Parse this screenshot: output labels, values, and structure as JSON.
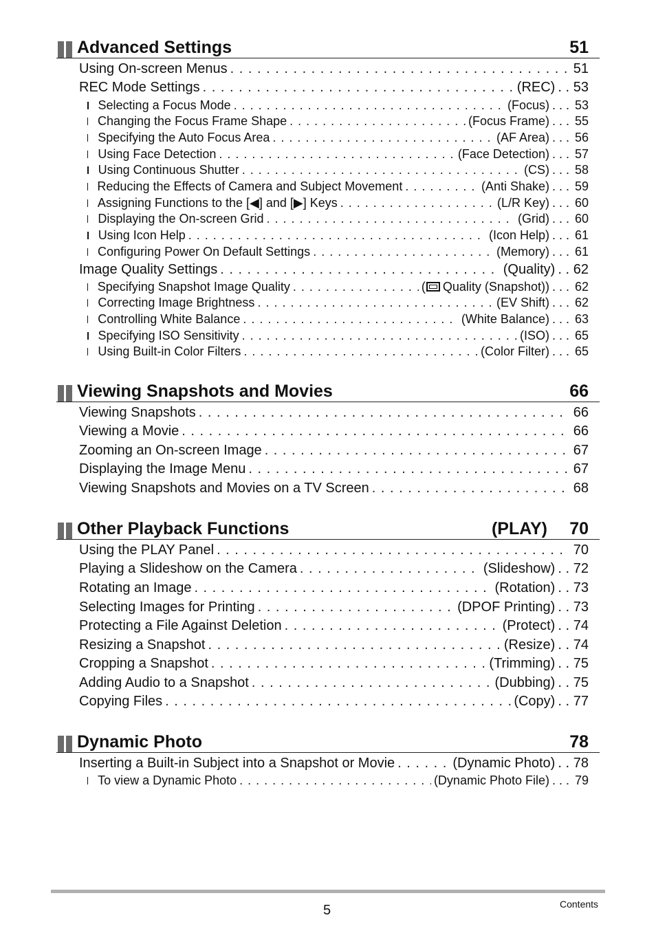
{
  "sections": [
    {
      "title": "Advanced Settings",
      "tag": "",
      "page": "51",
      "entries": [
        {
          "label": "Using On-screen Menus",
          "tag": "",
          "page": "51",
          "level": 1
        },
        {
          "label": "REC Mode Settings",
          "tag": "(REC)",
          "page": "53",
          "level": 1
        },
        {
          "label": "Selecting a Focus Mode",
          "tag": "(Focus)",
          "page": "53",
          "level": 2
        },
        {
          "label": "Changing the Focus Frame Shape",
          "tag": "(Focus Frame)",
          "page": "55",
          "level": 2
        },
        {
          "label": "Specifying the Auto Focus Area",
          "tag": "(AF Area)",
          "page": "56",
          "level": 2
        },
        {
          "label": "Using Face Detection",
          "tag": "(Face Detection)",
          "page": "57",
          "level": 2
        },
        {
          "label": "Using Continuous Shutter",
          "tag": "(CS)",
          "page": "58",
          "level": 2
        },
        {
          "label": "Reducing the Effects of Camera and Subject Movement",
          "tag": "(Anti Shake)",
          "page": "59",
          "level": 2
        },
        {
          "label": "Assigning Functions to the [◀] and [▶] Keys",
          "tag": "(L/R Key)",
          "page": "60",
          "level": 2
        },
        {
          "label": "Displaying the On-screen Grid",
          "tag": "(Grid)",
          "page": "60",
          "level": 2
        },
        {
          "label": "Using Icon Help",
          "tag": "(Icon Help)",
          "page": "61",
          "level": 2
        },
        {
          "label": "Configuring Power On Default Settings",
          "tag": "(Memory)",
          "page": "61",
          "level": 2
        },
        {
          "label": "Image Quality Settings",
          "tag": "(Quality)",
          "page": "62",
          "level": 1
        },
        {
          "label": "Specifying Snapshot Image Quality",
          "tag": "Quality (Snapshot))",
          "tag_prefix": "(",
          "tag_icon": "snapshot-quality-icon",
          "page": "62",
          "level": 2
        },
        {
          "label": "Correcting Image Brightness",
          "tag": "(EV Shift)",
          "page": "62",
          "level": 2
        },
        {
          "label": "Controlling White Balance",
          "tag": "(White Balance)",
          "page": "63",
          "level": 2
        },
        {
          "label": "Specifying ISO Sensitivity",
          "tag": "(ISO)",
          "page": "65",
          "level": 2
        },
        {
          "label": "Using Built-in Color Filters",
          "tag": "(Color Filter)",
          "page": "65",
          "level": 2
        }
      ]
    },
    {
      "title": "Viewing Snapshots and Movies",
      "tag": "",
      "page": "66",
      "entries": [
        {
          "label": "Viewing Snapshots",
          "tag": "",
          "page": "66",
          "level": 1
        },
        {
          "label": "Viewing a Movie",
          "tag": "",
          "page": "66",
          "level": 1
        },
        {
          "label": "Zooming an On-screen Image",
          "tag": "",
          "page": "67",
          "level": 1
        },
        {
          "label": "Displaying the Image Menu",
          "tag": "",
          "page": "67",
          "level": 1
        },
        {
          "label": "Viewing Snapshots and Movies on a TV Screen",
          "tag": "",
          "page": "68",
          "level": 1
        }
      ]
    },
    {
      "title": "Other Playback Functions",
      "tag": "(PLAY)",
      "page": "70",
      "entries": [
        {
          "label": "Using the PLAY Panel",
          "tag": "",
          "page": "70",
          "level": 1
        },
        {
          "label": "Playing a Slideshow on the Camera",
          "tag": "(Slideshow)",
          "page": "72",
          "level": 1
        },
        {
          "label": "Rotating an Image",
          "tag": "(Rotation)",
          "page": "73",
          "level": 1
        },
        {
          "label": "Selecting Images for Printing",
          "tag": "(DPOF Printing)",
          "page": "73",
          "level": 1
        },
        {
          "label": "Protecting a File Against Deletion",
          "tag": "(Protect)",
          "page": "74",
          "level": 1
        },
        {
          "label": "Resizing a Snapshot",
          "tag": "(Resize)",
          "page": "74",
          "level": 1
        },
        {
          "label": "Cropping a Snapshot",
          "tag": "(Trimming)",
          "page": "75",
          "level": 1
        },
        {
          "label": "Adding Audio to a Snapshot",
          "tag": "(Dubbing)",
          "page": "75",
          "level": 1
        },
        {
          "label": "Copying Files",
          "tag": "(Copy)",
          "page": "77",
          "level": 1
        }
      ]
    },
    {
      "title": "Dynamic Photo",
      "tag": "",
      "page": "78",
      "entries": [
        {
          "label": "Inserting a Built-in Subject into a Snapshot or Movie",
          "tag": "(Dynamic Photo)",
          "page": "78",
          "level": 1
        },
        {
          "label": "To view a Dynamic Photo",
          "tag": "(Dynamic Photo File)",
          "page": "79",
          "level": 2
        }
      ]
    }
  ],
  "footer": {
    "page_number": "5",
    "label": "Contents"
  },
  "icons": {
    "section_marker": "double-bar-icon",
    "sub_bullet": "square-bullet-icon"
  }
}
